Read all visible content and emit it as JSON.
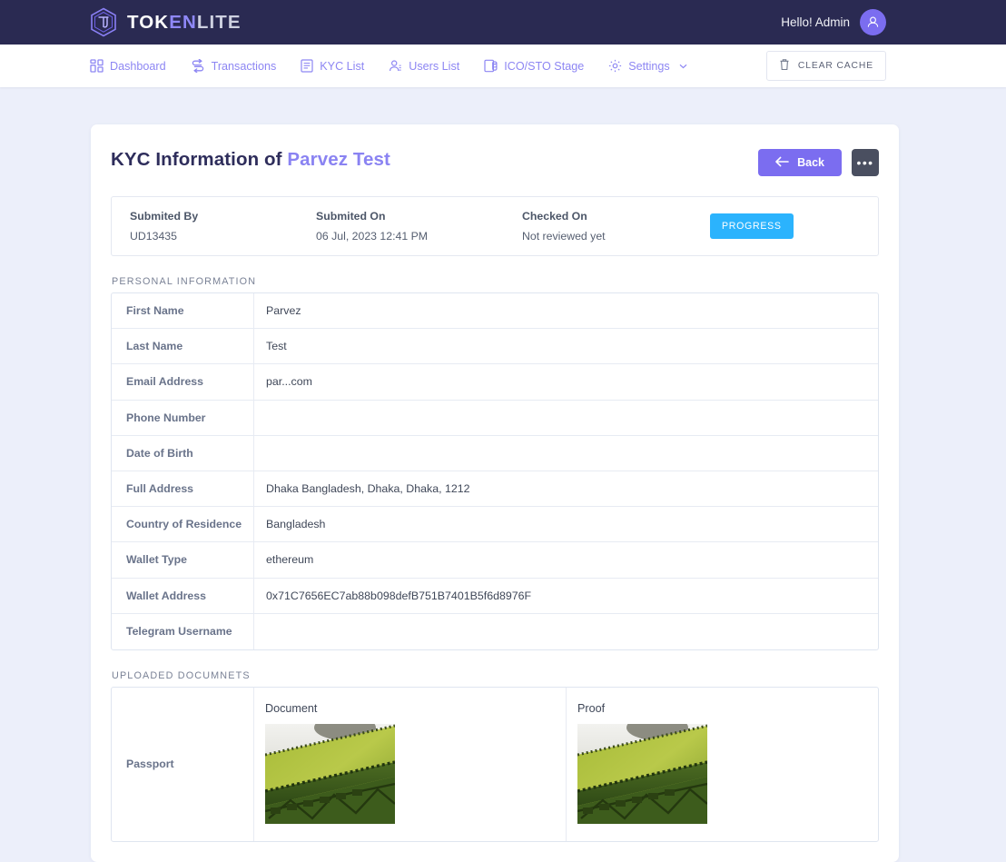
{
  "brand": {
    "part1": "TOK",
    "part2": "EN",
    "part3": "LITE",
    "logo_icon": "tokenlite-cube-logo"
  },
  "topbar": {
    "greeting": "Hello! Admin",
    "avatar_icon": "user-avatar-icon"
  },
  "nav": {
    "items": [
      {
        "label": "Dashboard",
        "icon": "grid-dashboard-icon"
      },
      {
        "label": "Transactions",
        "icon": "transfer-arrows-icon"
      },
      {
        "label": "KYC List",
        "icon": "document-list-icon"
      },
      {
        "label": "Users List",
        "icon": "users-icon"
      },
      {
        "label": "ICO/STO Stage",
        "icon": "coins-stack-icon"
      },
      {
        "label": "Settings",
        "icon": "gear-icon",
        "caret": "chevron-down-icon"
      }
    ],
    "clear_cache": {
      "label": "CLEAR CACHE",
      "icon": "trash-icon"
    }
  },
  "page": {
    "title_prefix": "KYC Information of",
    "title_name": "Parvez Test",
    "back_label": "Back",
    "back_icon": "arrow-left-icon",
    "more_label": "•••",
    "accent_color": "#7b6df0"
  },
  "summary": {
    "submitted_by_label": "Submited By",
    "submitted_by_value": "UD13435",
    "submitted_on_label": "Submited On",
    "submitted_on_value": "06 Jul, 2023 12:41 PM",
    "checked_on_label": "Checked On",
    "checked_on_value": "Not reviewed yet",
    "status_badge": "PROGRESS",
    "status_color": "#2bb3fd"
  },
  "personal": {
    "section_label": "PERSONAL INFORMATION",
    "rows": [
      {
        "label": "First Name",
        "value": "Parvez"
      },
      {
        "label": "Last Name",
        "value": "Test"
      },
      {
        "label": "Email Address",
        "value": "par...com"
      },
      {
        "label": "Phone Number",
        "value": ""
      },
      {
        "label": "Date of Birth",
        "value": ""
      },
      {
        "label": "Full Address",
        "value": "Dhaka Bangladesh, Dhaka, Dhaka, 1212"
      },
      {
        "label": "Country of Residence",
        "value": "Bangladesh"
      },
      {
        "label": "Wallet Type",
        "value": "ethereum"
      },
      {
        "label": "Wallet Address",
        "value": "0x71C7656EC7ab88b098defB751B7401B5f6d8976F"
      },
      {
        "label": "Telegram Username",
        "value": ""
      }
    ]
  },
  "documents": {
    "section_label": "UPLOADED DOCUMNETS",
    "doc_type": "Passport",
    "cells": [
      {
        "title": "Document",
        "image_icon": "kyc-document-thumbnail"
      },
      {
        "title": "Proof",
        "image_icon": "kyc-proof-thumbnail"
      }
    ]
  }
}
